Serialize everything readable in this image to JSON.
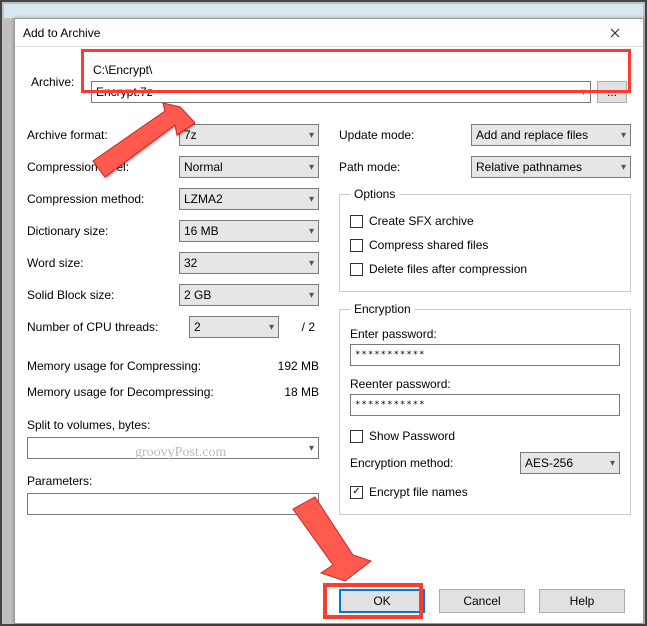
{
  "window": {
    "title": "Add to Archive"
  },
  "archive": {
    "label": "Archive:",
    "path": "C:\\Encrypt\\",
    "filename": "Encrypt.7z",
    "browse": "..."
  },
  "left": {
    "format_label": "Archive format:",
    "format_value": "7z",
    "level_label": "Compression level:",
    "level_value": "Normal",
    "method_label": "Compression method:",
    "method_value": "LZMA2",
    "dict_label": "Dictionary size:",
    "dict_value": "16 MB",
    "word_label": "Word size:",
    "word_value": "32",
    "block_label": "Solid Block size:",
    "block_value": "2 GB",
    "threads_label": "Number of CPU threads:",
    "threads_value": "2",
    "threads_total": "/ 2",
    "mem_compress_label": "Memory usage for Compressing:",
    "mem_compress_value": "192 MB",
    "mem_decompress_label": "Memory usage for Decompressing:",
    "mem_decompress_value": "18 MB",
    "split_label": "Split to volumes, bytes:",
    "split_value": "",
    "params_label": "Parameters:",
    "params_value": ""
  },
  "right": {
    "update_label": "Update mode:",
    "update_value": "Add and replace files",
    "path_label": "Path mode:",
    "path_value": "Relative pathnames",
    "options_legend": "Options",
    "opt_sfx": "Create SFX archive",
    "opt_shared": "Compress shared files",
    "opt_delete": "Delete files after compression",
    "enc_legend": "Encryption",
    "enter_pw": "Enter password:",
    "reenter_pw": "Reenter password:",
    "pw_mask": "***********",
    "show_pw": "Show Password",
    "enc_method_label": "Encryption method:",
    "enc_method_value": "AES-256",
    "enc_names": "Encrypt file names"
  },
  "buttons": {
    "ok": "OK",
    "cancel": "Cancel",
    "help": "Help"
  },
  "watermark": "groovyPost.com",
  "checks": {
    "enc_names": "✓"
  }
}
